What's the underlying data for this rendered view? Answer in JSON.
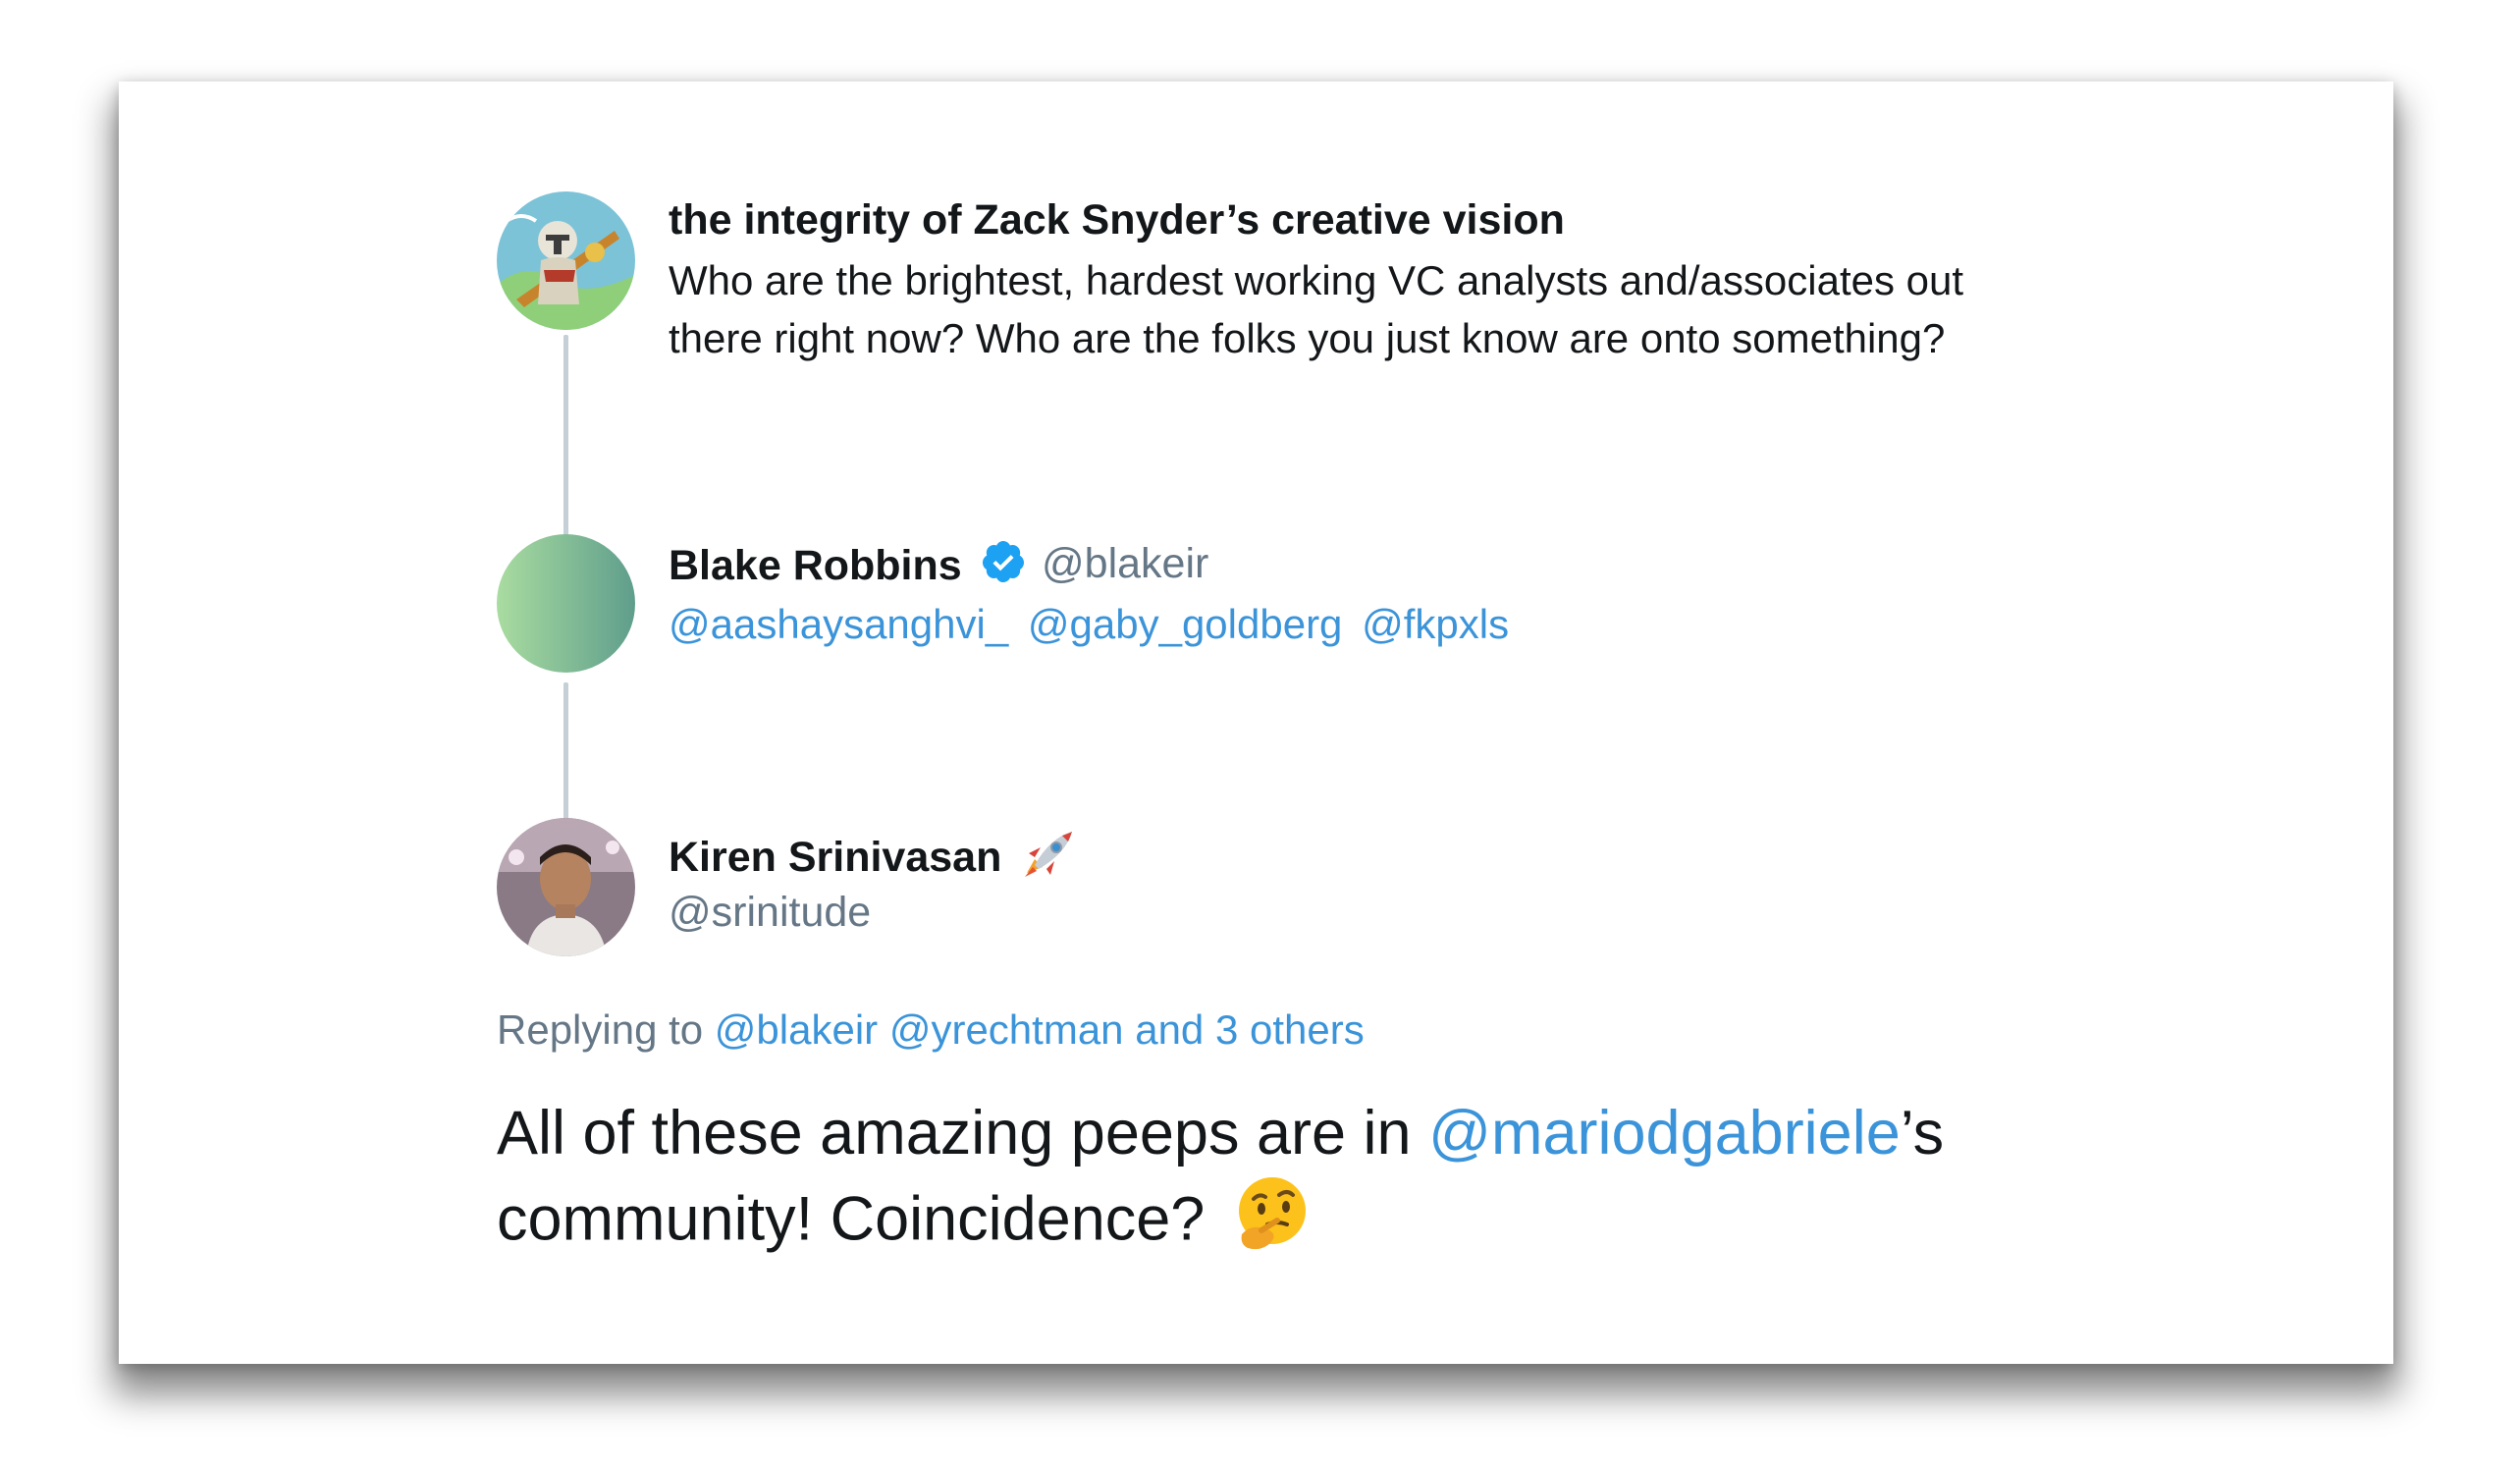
{
  "thread": {
    "tweet1": {
      "name": "the integrity of Zack Snyder’s creative vision",
      "text_line1": "Who are the brightest, hardest working VC analysts and/associates out",
      "text_line2": "there right now? Who are the folks you just know are onto something?"
    },
    "tweet2": {
      "name": "Blake Robbins",
      "handle": "@blakeir",
      "mentions": [
        "@aashaysanghvi_",
        "@gaby_goldberg",
        "@fkpxls"
      ]
    },
    "tweet3": {
      "name": "Kiren Srinivasan",
      "handle": "@srinitude",
      "replying_prefix": "Replying to",
      "replying_to": [
        "@blakeir",
        "@yrechtman",
        "and 3 others"
      ],
      "text_part1": "All of these amazing peeps are in ",
      "text_mention": "@mariodgabriele",
      "text_part2": "’s",
      "text_line2": "community! Coincidence?"
    }
  },
  "colors": {
    "link": "#3b94d9",
    "text": "#14171a",
    "secondary": "#657786",
    "verified": "#1da1f2"
  },
  "icons": {
    "verified": "verified-badge-icon",
    "rocket": "rocket-emoji-icon",
    "thinking": "thinking-face-emoji-icon"
  }
}
